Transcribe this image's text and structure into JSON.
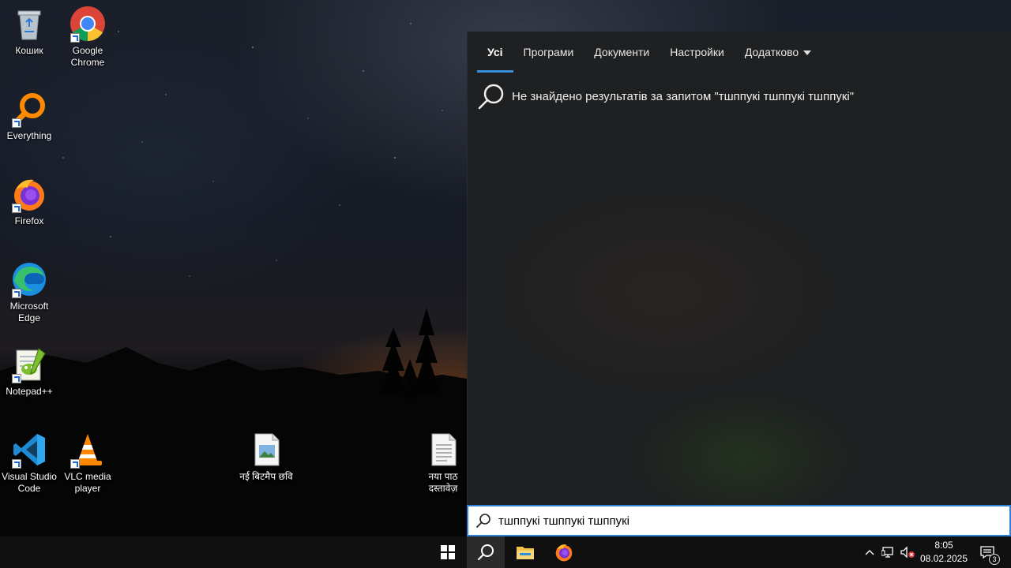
{
  "desktop": {
    "icons": [
      {
        "label": "Кошик"
      },
      {
        "label": "Google Chrome"
      },
      {
        "label": "Everything"
      },
      {
        "label": "Firefox"
      },
      {
        "label": "Microsoft Edge"
      },
      {
        "label": "Notepad++"
      },
      {
        "label": "Visual Studio Code"
      },
      {
        "label": "VLC media player"
      },
      {
        "label": "नई बिटमैप छवि"
      },
      {
        "label": "नया पाठ दस्तावेज़"
      }
    ]
  },
  "search_panel": {
    "tabs": [
      {
        "label": "Усі",
        "active": true
      },
      {
        "label": "Програми"
      },
      {
        "label": "Документи"
      },
      {
        "label": "Настройки"
      },
      {
        "label": "Додатково"
      }
    ],
    "no_results_text": "Не знайдено результатів за запитом \"тшппукі тшппукі тшппукі\"",
    "search_box_value": "тшппукі тшппукі тшппукі"
  },
  "taskbar": {
    "clock_time": "8:05",
    "clock_date": "08.02.2025",
    "notification_count": "3"
  },
  "colors": {
    "accent": "#3b8fd9",
    "panel_bg": "#1f2021",
    "taskbar_bg": "#101010"
  }
}
